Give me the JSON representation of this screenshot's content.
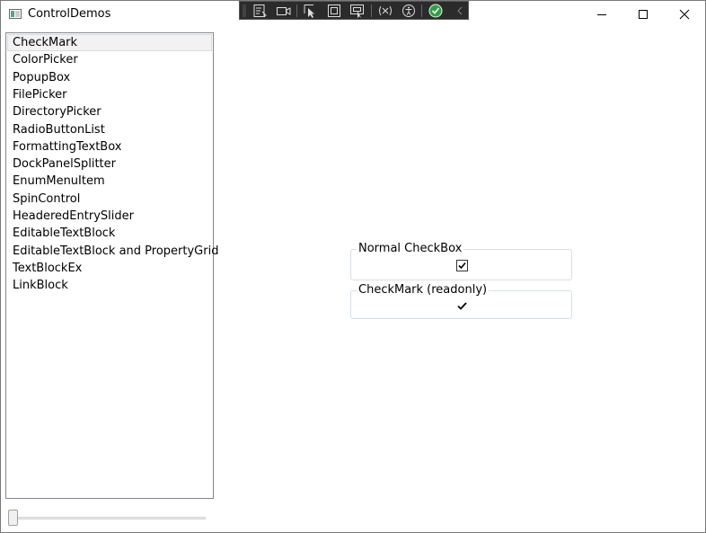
{
  "window": {
    "title": "ControlDemos"
  },
  "devtools": {
    "tools": [
      "live-visual-tree-icon",
      "video-icon",
      "select-element-icon",
      "display-layout-adorners-icon",
      "track-focus-icon",
      "hot-reload-icon",
      "accessibility-icon",
      "check-icon",
      "collapse-icon"
    ]
  },
  "sidebar": {
    "selected_index": 0,
    "items": [
      {
        "label": "CheckMark"
      },
      {
        "label": "ColorPicker"
      },
      {
        "label": "PopupBox"
      },
      {
        "label": "FilePicker"
      },
      {
        "label": "DirectoryPicker"
      },
      {
        "label": "RadioButtonList"
      },
      {
        "label": "FormattingTextBox"
      },
      {
        "label": "DockPanelSplitter"
      },
      {
        "label": "EnumMenuItem"
      },
      {
        "label": "SpinControl"
      },
      {
        "label": "HeaderedEntrySlider"
      },
      {
        "label": "EditableTextBlock"
      },
      {
        "label": "EditableTextBlock and PropertyGrid"
      },
      {
        "label": "TextBlockEx"
      },
      {
        "label": "LinkBlock"
      }
    ]
  },
  "slider": {
    "value_fraction": 0.0
  },
  "main": {
    "normal_group": {
      "header": "Normal CheckBox",
      "checked": true
    },
    "readonly_group": {
      "header": "CheckMark (readonly)",
      "checked": true
    }
  }
}
